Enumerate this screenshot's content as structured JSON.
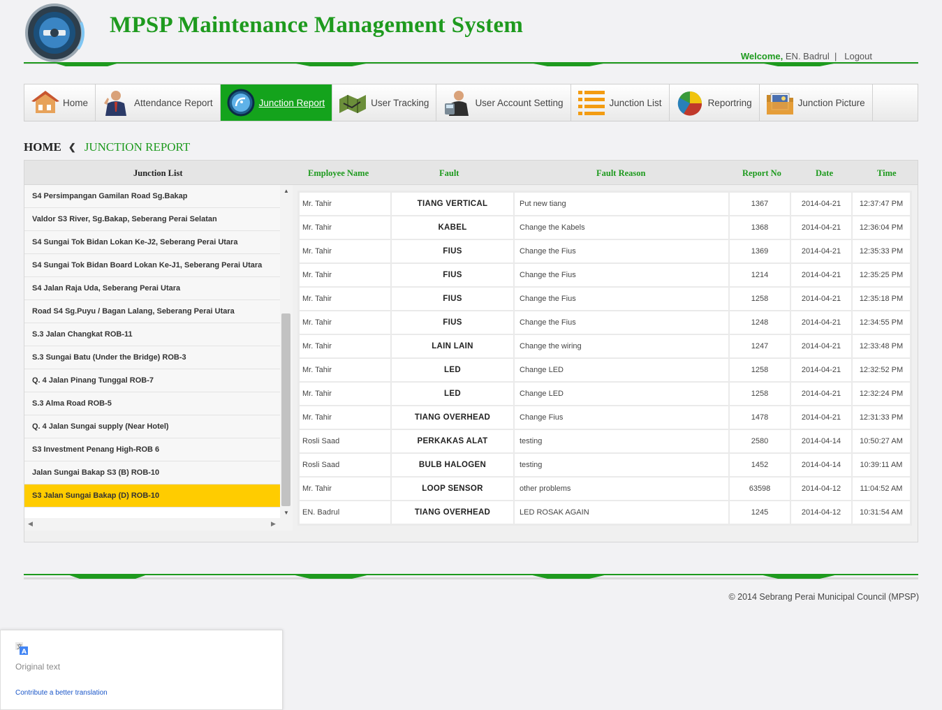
{
  "header": {
    "title": "MPSP Maintenance Management System",
    "welcome_label": "Welcome,",
    "user_name": "EN. Badrul",
    "separator": "|",
    "logout": "Logout"
  },
  "nav": [
    {
      "label": "Home",
      "icon": "house-icon",
      "active": false
    },
    {
      "label": "Attendance Report",
      "icon": "businessman-icon",
      "active": false
    },
    {
      "label": "Junction Report",
      "icon": "satellite-dish-icon",
      "active": true
    },
    {
      "label": "User Tracking",
      "icon": "map-tracking-icon",
      "active": false
    },
    {
      "label": "User Account Setting",
      "icon": "user-account-icon",
      "active": false
    },
    {
      "label": "Junction List",
      "icon": "list-icon",
      "active": false
    },
    {
      "label": "Reportring",
      "icon": "pie-chart-icon",
      "active": false
    },
    {
      "label": "Junction Picture",
      "icon": "picture-folder-icon",
      "active": false
    }
  ],
  "breadcrumb": {
    "home": "HOME",
    "current": "JUNCTION REPORT"
  },
  "columns": {
    "junction_list": "Junction List",
    "employee": "Employee Name",
    "fault": "Fault",
    "reason": "Fault Reason",
    "report_no": "Report No",
    "date": "Date",
    "time": "Time"
  },
  "junctions": [
    "S4 Persimpangan Gamilan Road Sg.Bakap",
    "Valdor S3 River, Sg.Bakap, Seberang Perai Selatan",
    "S4 Sungai Tok Bidan Lokan Ke-J2, Seberang Perai Utara",
    "S4 Sungai Tok Bidan Board Lokan Ke-J1, Seberang Perai Utara",
    "S4 Jalan Raja Uda, Seberang Perai Utara",
    "Road S4 Sg.Puyu / Bagan Lalang, Seberang Perai Utara",
    "S.3 Jalan Changkat ROB-11",
    "S.3 Sungai Batu (Under the Bridge) ROB-3",
    "Q. 4 Jalan Pinang Tunggal ROB-7",
    "S.3 Alma Road ROB-5",
    "Q. 4 Jalan Sungai supply (Near Hotel)",
    "S3 Investment Penang High-ROB 6",
    "Jalan Sungai Bakap  S3 (B) ROB-10",
    "S3 Jalan Sungai Bakap (D) ROB-10"
  ],
  "selected_junction_index": 13,
  "reports": [
    {
      "employee": "Mr. Tahir",
      "fault": "TIANG VERTICAL",
      "reason": "Put new tiang",
      "report_no": "1367",
      "date": "2014-04-21",
      "time": "12:37:47 PM"
    },
    {
      "employee": "Mr. Tahir",
      "fault": "KABEL",
      "reason": "Change the Kabels",
      "report_no": "1368",
      "date": "2014-04-21",
      "time": "12:36:04 PM"
    },
    {
      "employee": "Mr. Tahir",
      "fault": "FIUS",
      "reason": "Change the Fius",
      "report_no": "1369",
      "date": "2014-04-21",
      "time": "12:35:33 PM"
    },
    {
      "employee": "Mr. Tahir",
      "fault": "FIUS",
      "reason": "Change the Fius",
      "report_no": "1214",
      "date": "2014-04-21",
      "time": "12:35:25 PM"
    },
    {
      "employee": "Mr. Tahir",
      "fault": "FIUS",
      "reason": "Change the Fius",
      "report_no": "1258",
      "date": "2014-04-21",
      "time": "12:35:18 PM"
    },
    {
      "employee": "Mr. Tahir",
      "fault": "FIUS",
      "reason": "Change the Fius",
      "report_no": "1248",
      "date": "2014-04-21",
      "time": "12:34:55 PM"
    },
    {
      "employee": "Mr. Tahir",
      "fault": "LAIN LAIN",
      "reason": "Change the wiring",
      "report_no": "1247",
      "date": "2014-04-21",
      "time": "12:33:48 PM"
    },
    {
      "employee": "Mr. Tahir",
      "fault": "LED",
      "reason": "Change LED",
      "report_no": "1258",
      "date": "2014-04-21",
      "time": "12:32:52 PM"
    },
    {
      "employee": "Mr. Tahir",
      "fault": "LED",
      "reason": "Change LED",
      "report_no": "1258",
      "date": "2014-04-21",
      "time": "12:32:24 PM"
    },
    {
      "employee": "Mr. Tahir",
      "fault": "TIANG OVERHEAD",
      "reason": "Change Fius",
      "report_no": "1478",
      "date": "2014-04-21",
      "time": "12:31:33 PM"
    },
    {
      "employee": "Rosli Saad",
      "fault": "PERKAKAS ALAT",
      "reason": "testing",
      "report_no": "2580",
      "date": "2014-04-14",
      "time": "10:50:27 AM"
    },
    {
      "employee": "Rosli Saad",
      "fault": "BULB HALOGEN",
      "reason": "testing",
      "report_no": "1452",
      "date": "2014-04-14",
      "time": "10:39:11 AM"
    },
    {
      "employee": "Mr. Tahir",
      "fault": "LOOP SENSOR",
      "reason": "other problems",
      "report_no": "63598",
      "date": "2014-04-12",
      "time": "11:04:52 AM"
    },
    {
      "employee": "EN. Badrul",
      "fault": "TIANG OVERHEAD",
      "reason": "LED ROSAK AGAIN",
      "report_no": "1245",
      "date": "2014-04-12",
      "time": "10:31:54 AM"
    }
  ],
  "footer": {
    "copyright": "© 2014 Sebrang Perai Municipal Council (MPSP)"
  },
  "translate_popup": {
    "original_text": "Original text",
    "contribute": "Contribute a better translation"
  },
  "colors": {
    "brand_green": "#1e9a1e",
    "active_nav": "#14a31c",
    "selected_row": "#ffcc00"
  }
}
